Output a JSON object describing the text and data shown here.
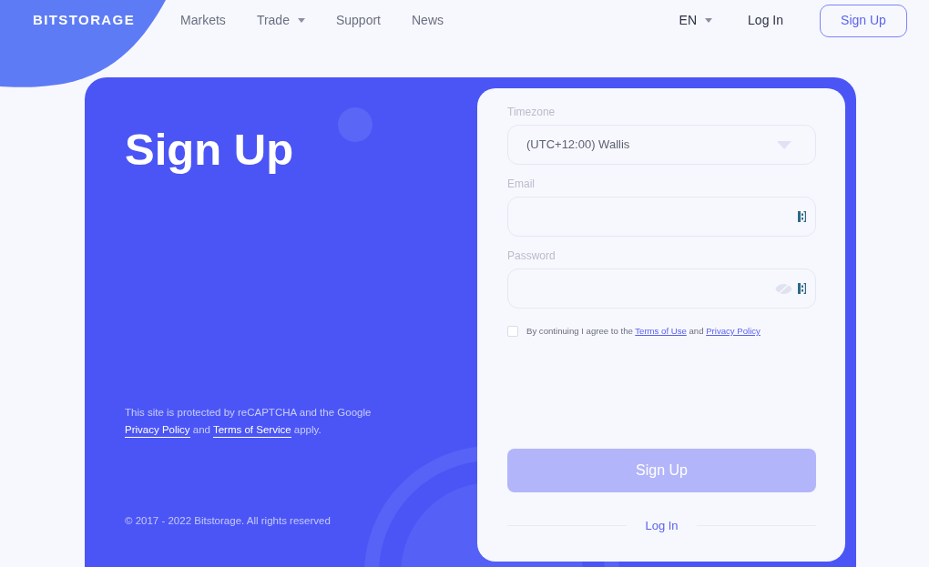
{
  "header": {
    "logo": "BITSTORAGE",
    "nav": [
      {
        "label": "Markets",
        "kind": "link"
      },
      {
        "label": "Trade",
        "kind": "dropdown"
      },
      {
        "label": "Support",
        "kind": "link"
      },
      {
        "label": "News",
        "kind": "link"
      }
    ],
    "language": "EN",
    "login": "Log In",
    "signup": "Sign Up"
  },
  "hero": {
    "title": "Sign Up",
    "recaptcha_notice": [
      {
        "kind": "text",
        "text": "This site is protected by reCAPTCHA and the Google "
      },
      {
        "kind": "link",
        "text": "Privacy Policy"
      },
      {
        "kind": "text",
        "text": " and "
      },
      {
        "kind": "link",
        "text": "Terms of Service"
      },
      {
        "kind": "text",
        "text": " apply."
      }
    ],
    "copyright": "© 2017 - 2022 Bitstorage. All rights reserved"
  },
  "form": {
    "fields": [
      {
        "kind": "select",
        "label": "Timezone",
        "value": "(UTC+12:00) Wallis"
      },
      {
        "kind": "email",
        "label": "Email"
      },
      {
        "kind": "password",
        "label": "Password"
      }
    ],
    "agreement": {
      "checked": false,
      "parts": [
        {
          "kind": "text",
          "text": "By continuing I agree to the "
        },
        {
          "kind": "link",
          "text": "Terms of Use"
        },
        {
          "kind": "text",
          "text": " and "
        },
        {
          "kind": "link",
          "text": "Privacy Policy"
        }
      ]
    },
    "submit": {
      "label": "Sign Up",
      "disabled": true
    },
    "login_link": "Log In"
  }
}
